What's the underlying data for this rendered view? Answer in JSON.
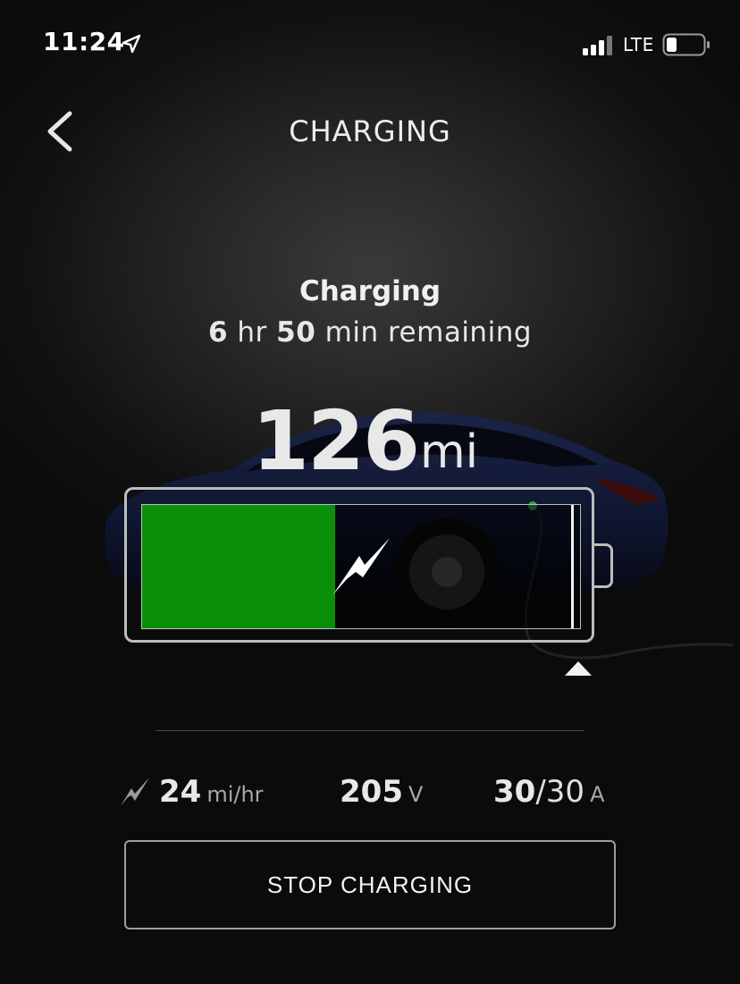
{
  "status_bar": {
    "time": "11:24",
    "network": "LTE",
    "location_icon": "location-arrow-icon",
    "signal_icon": "cellular-signal-icon",
    "battery_icon": "phone-battery-icon"
  },
  "header": {
    "title": "CHARGING",
    "back_icon": "chevron-left-icon"
  },
  "charge": {
    "status": "Charging",
    "hours": "6",
    "hours_unit": "hr",
    "minutes": "50",
    "minutes_unit": "min remaining",
    "range_value": "126",
    "range_unit": "mi",
    "battery_level_fraction": 0.44,
    "charge_limit_fraction": 0.99,
    "fill_color": "#0a8f0a"
  },
  "stats": {
    "rate_value": "24",
    "rate_unit": "mi/hr",
    "voltage_value": "205",
    "voltage_unit": "V",
    "current_value": "30",
    "current_separator": "/",
    "current_max": "30",
    "current_unit": "A"
  },
  "actions": {
    "stop_label": "STOP CHARGING"
  }
}
